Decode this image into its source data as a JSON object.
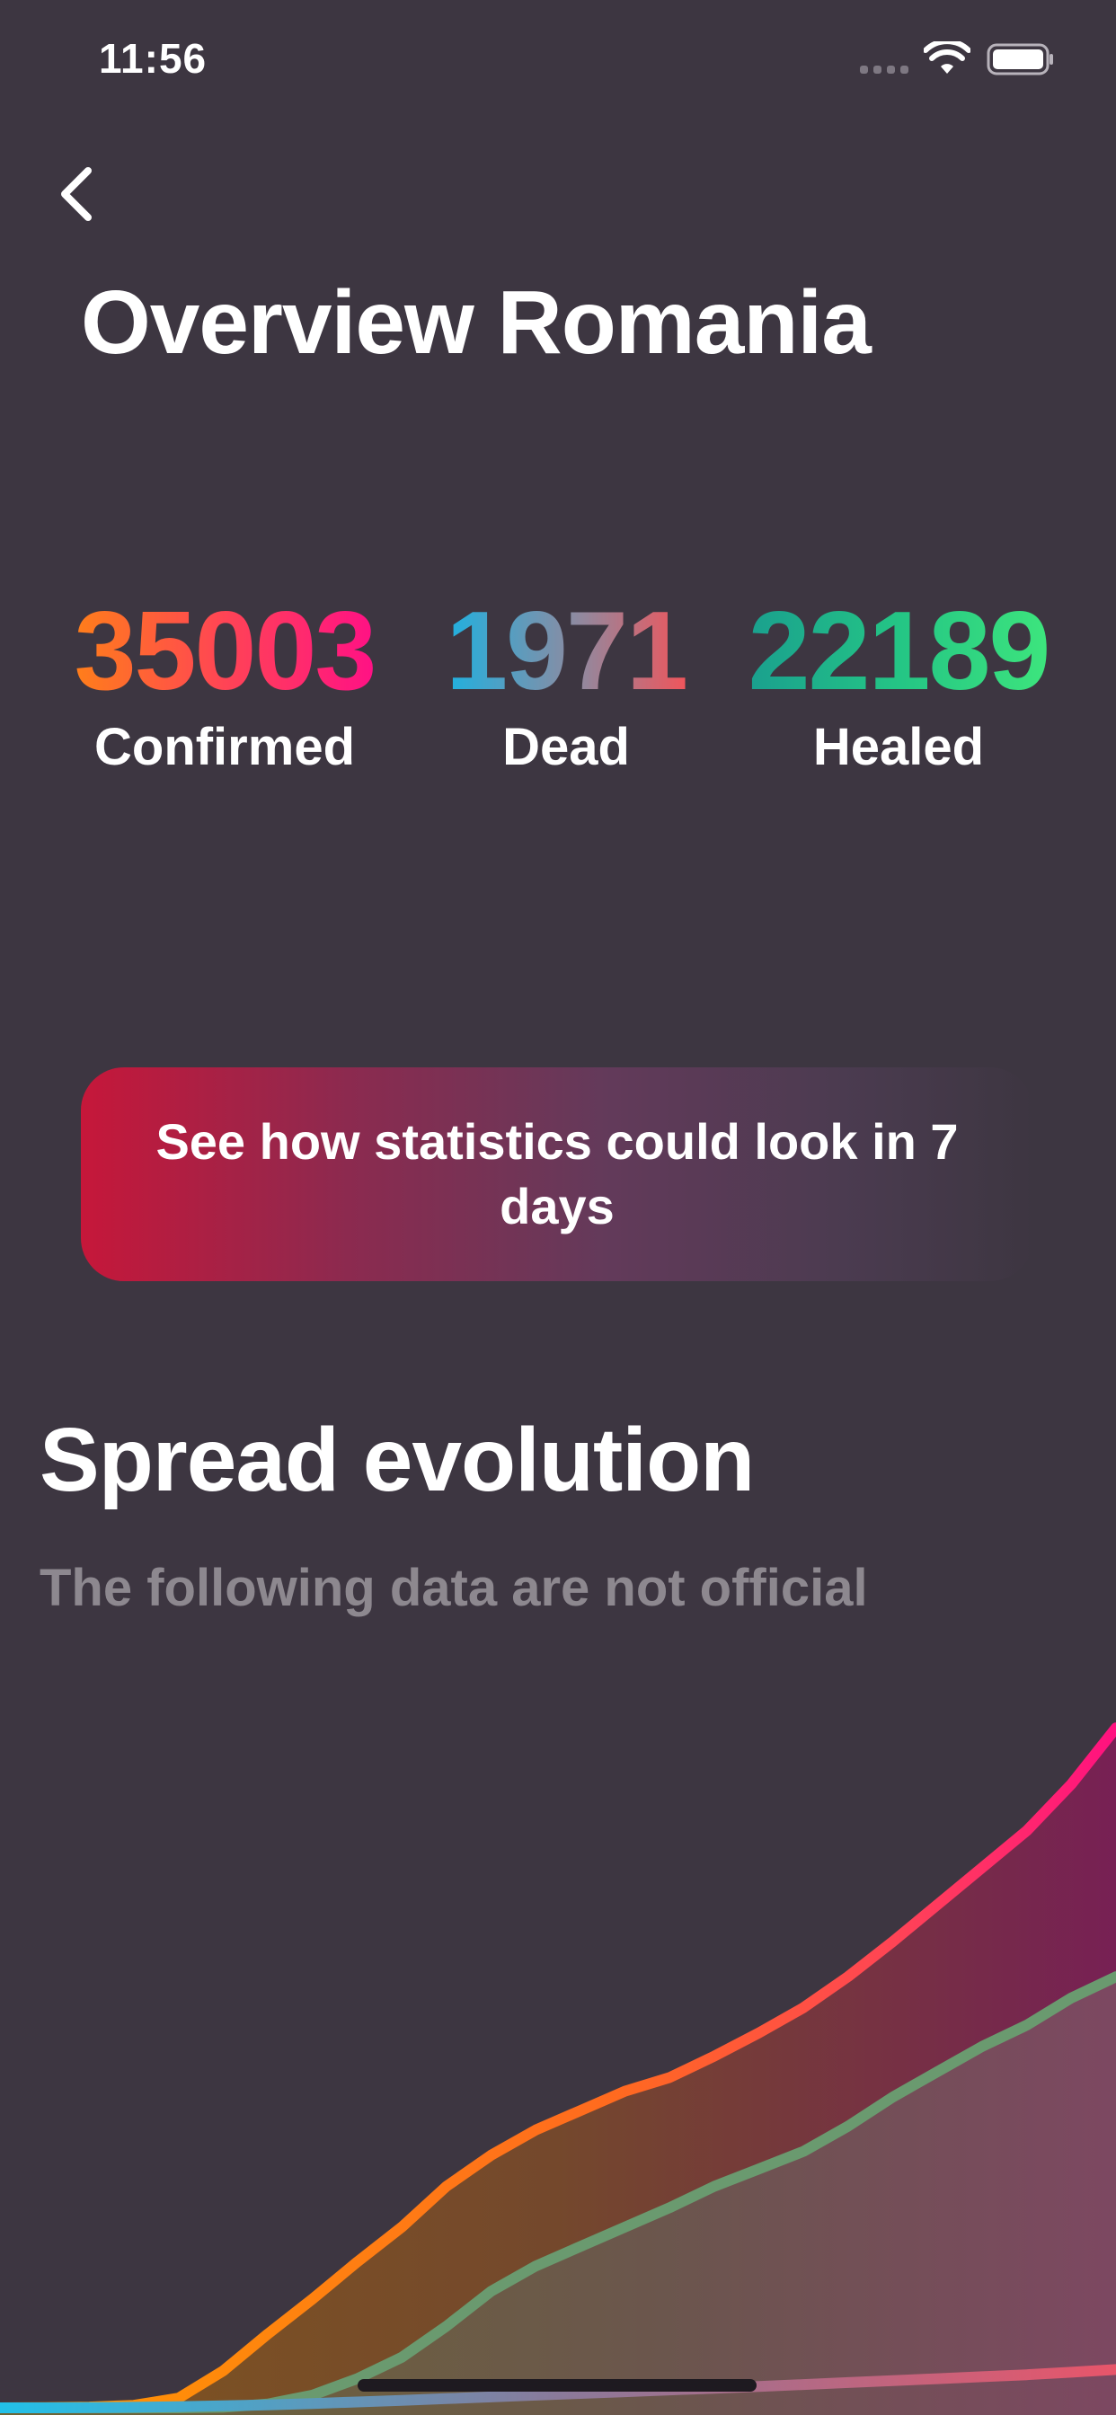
{
  "status_bar": {
    "time": "11:56"
  },
  "header": {
    "back_icon": "chevron-left-icon",
    "title": "Overview Romania"
  },
  "stats": {
    "confirmed": {
      "value": "35003",
      "label": "Confirmed",
      "gradient": [
        "#ff7e1a",
        "#ff1185"
      ]
    },
    "dead": {
      "value": "1971",
      "label": "Dead",
      "gradient": [
        "#1fb1e0",
        "#f0555b"
      ]
    },
    "healed": {
      "value": "22189",
      "label": "Healed",
      "gradient": [
        "#1aa08e",
        "#3de57d"
      ]
    }
  },
  "prediction_button": {
    "label": "See how statistics could look in 7 days"
  },
  "spread_section": {
    "title": "Spread evolution",
    "subtitle": "The following data are not official"
  },
  "colors": {
    "background": "#3d3641",
    "confirmed_start": "#ff8a00",
    "confirmed_end": "#ff1180",
    "healed_line": "#6a9a6f",
    "dead_line_start": "#22c1e8",
    "dead_line_end": "#e8556a"
  },
  "chart_data": {
    "type": "area",
    "title": "",
    "xlabel": "",
    "ylabel": "",
    "x": [
      0,
      4,
      8,
      12,
      16,
      20,
      24,
      28,
      32,
      36,
      40,
      44,
      48,
      52,
      56,
      60,
      64,
      68,
      72,
      76,
      80,
      84,
      88,
      92,
      96,
      100
    ],
    "ylim": [
      0,
      37000
    ],
    "series": [
      {
        "values": [
          0,
          10,
          40,
          130,
          500,
          1900,
          3800,
          5600,
          7500,
          9300,
          11400,
          13000,
          14300,
          15300,
          16300,
          17000,
          18100,
          19300,
          20600,
          22200,
          24000,
          25900,
          27800,
          29700,
          32100,
          35003
        ]
      },
      {
        "values": [
          0,
          0,
          0,
          0,
          0,
          30,
          200,
          650,
          1500,
          2600,
          4200,
          6000,
          7300,
          8300,
          9300,
          10300,
          11400,
          12300,
          13200,
          14500,
          16000,
          17300,
          18600,
          19700,
          21100,
          22189
        ]
      },
      {
        "values": [
          0,
          0,
          10,
          30,
          60,
          100,
          150,
          220,
          300,
          380,
          470,
          560,
          650,
          740,
          830,
          920,
          1010,
          1100,
          1200,
          1300,
          1400,
          1500,
          1600,
          1700,
          1830,
          1971
        ]
      }
    ]
  }
}
